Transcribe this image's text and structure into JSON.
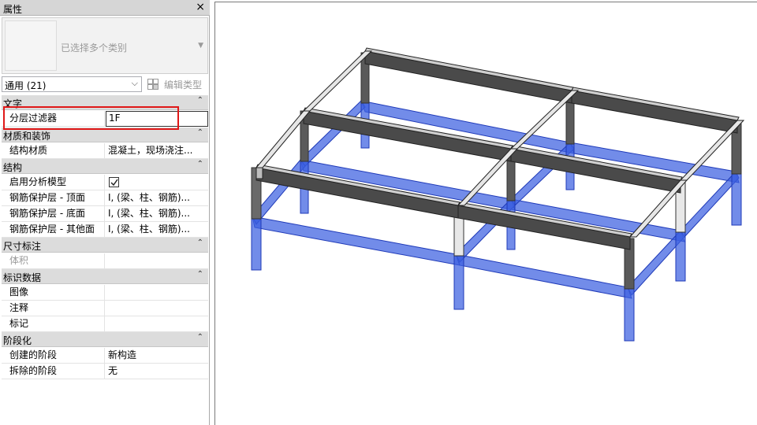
{
  "panel": {
    "title": "属性",
    "close_glyph": "×",
    "preview_label": "已选择多个类别",
    "preview_arrow": "▼",
    "type_selector": "通用 (21)",
    "type_dropdown_glyph": "⌵",
    "edit_type_label": "编辑类型",
    "collapse_glyph": "⌃"
  },
  "sections": {
    "text": {
      "title": "文字",
      "rows": [
        {
          "key": "分层过滤器",
          "value": "1F"
        }
      ]
    },
    "materials": {
      "title": "材质和装饰",
      "rows": [
        {
          "key": "结构材质",
          "value": "混凝土，现场浇注..."
        }
      ]
    },
    "structure": {
      "title": "结构",
      "rows": [
        {
          "key": "启用分析模型",
          "value": ""
        },
        {
          "key": "钢筋保护层 - 顶面",
          "value": "I, (梁、柱、钢筋)..."
        },
        {
          "key": "钢筋保护层 - 底面",
          "value": "I, (梁、柱、钢筋)..."
        },
        {
          "key": "钢筋保护层 - 其他面",
          "value": "I, (梁、柱、钢筋)..."
        }
      ]
    },
    "dimensions": {
      "title": "尺寸标注",
      "rows": [
        {
          "key": "体积",
          "value": ""
        }
      ]
    },
    "identity": {
      "title": "标识数据",
      "rows": [
        {
          "key": "图像",
          "value": ""
        },
        {
          "key": "注释",
          "value": ""
        },
        {
          "key": "标记",
          "value": ""
        }
      ]
    },
    "phasing": {
      "title": "阶段化",
      "rows": [
        {
          "key": "创建的阶段",
          "value": "新构造"
        },
        {
          "key": "拆除的阶段",
          "value": "无"
        }
      ]
    }
  },
  "icons": {
    "close": "close-icon",
    "edit_type": "edit-type-icon",
    "checkbox": "checkmark-icon",
    "collapse": "chevron-up-icon"
  },
  "colors": {
    "highlight_box": "#e01818",
    "selected_blue": "#3c5fe0",
    "beam_dark": "#555555",
    "beam_light": "#e6e6e6"
  },
  "state": {
    "analysis_model_enabled": true
  }
}
